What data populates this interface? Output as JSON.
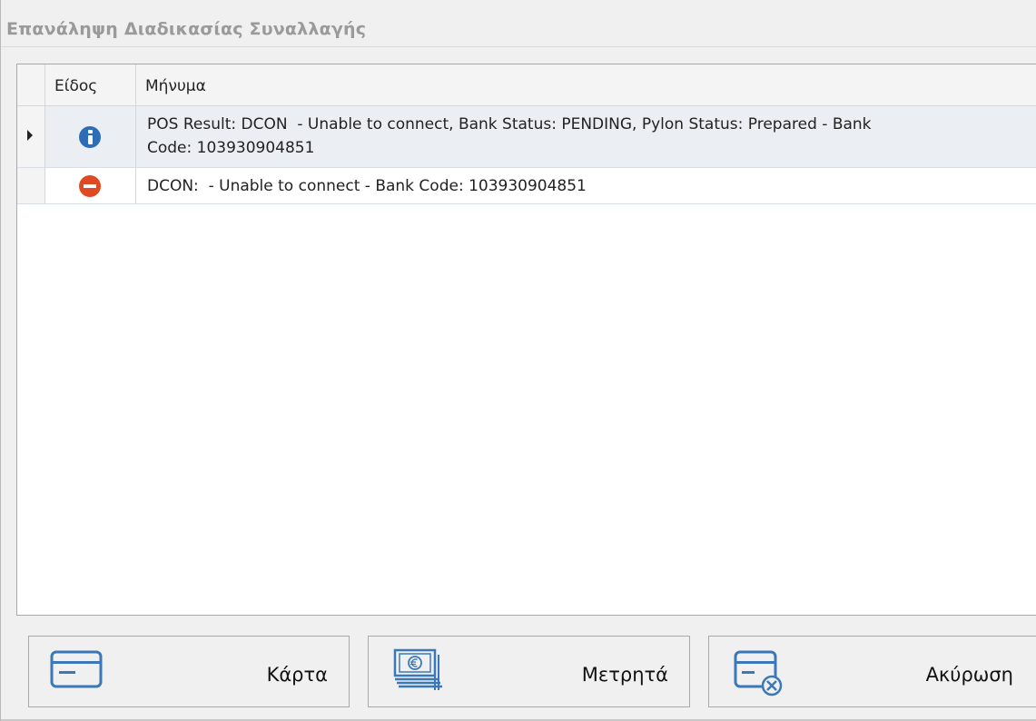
{
  "window": {
    "title": "Επανάληψη Διαδικασίας Συναλλαγής"
  },
  "grid": {
    "columns": {
      "type": "Είδος",
      "message": "Μήνυμα"
    },
    "rows": [
      {
        "icon": "info-icon",
        "selected": true,
        "message": "POS Result: DCON  - Unable to connect, Bank Status: PENDING, Pylon Status: Prepared - Bank\nCode: 103930904851"
      },
      {
        "icon": "stop-icon",
        "selected": false,
        "message": "DCON:  - Unable to connect - Bank Code: 103930904851"
      }
    ]
  },
  "buttons": {
    "card": {
      "label": "Κάρτα",
      "icon": "credit-card-icon"
    },
    "cash": {
      "label": "Μετρητά",
      "icon": "cash-euro-icon"
    },
    "cancel": {
      "label": "Ακύρωση",
      "icon": "card-cancel-icon"
    }
  },
  "colors": {
    "info": "#2d6cb7",
    "error": "#df4a25",
    "iconBlue": "#3a78b8",
    "selectedRow": "#ebeef3"
  }
}
